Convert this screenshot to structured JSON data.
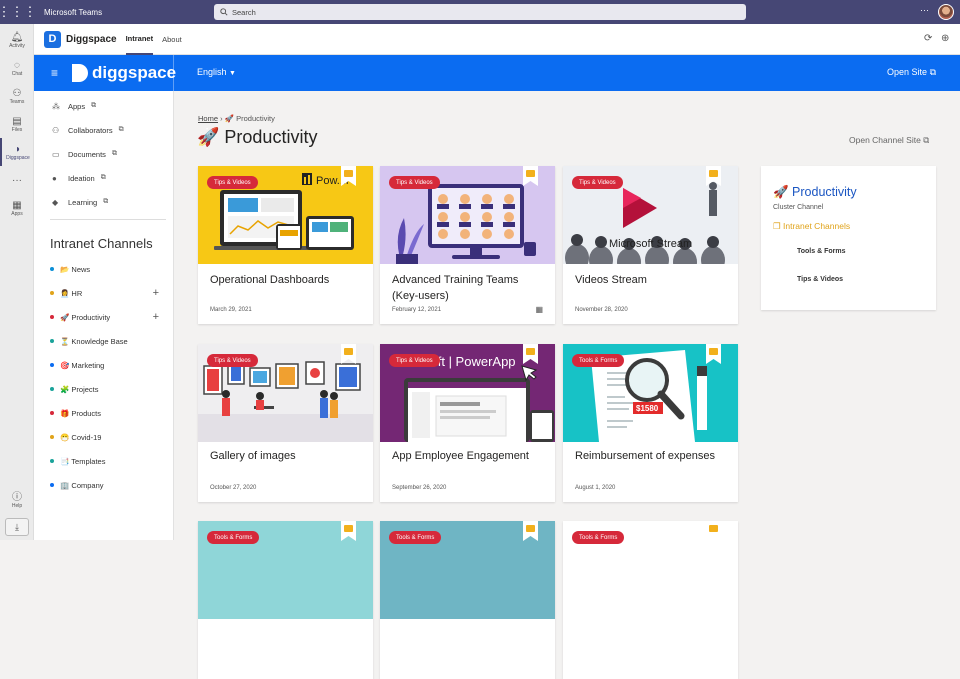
{
  "teams": {
    "app_name": "Microsoft Teams",
    "search_placeholder": "Search",
    "rail": [
      {
        "label": "Activity",
        "icon": "bell-icon"
      },
      {
        "label": "Chat",
        "icon": "chat-icon"
      },
      {
        "label": "Teams",
        "icon": "teams-icon"
      },
      {
        "label": "Files",
        "icon": "files-icon"
      },
      {
        "label": "Diggspace",
        "icon": "diggspace-icon"
      },
      {
        "label": "...",
        "icon": "more-icon"
      },
      {
        "label": "Apps",
        "icon": "apps-icon"
      }
    ],
    "help_label": "Help"
  },
  "tabbar": {
    "app": "Diggspace",
    "tabs": [
      "Intranet",
      "About"
    ]
  },
  "header": {
    "brand": "diggspace",
    "language": "English",
    "open_site": "Open Site"
  },
  "sidebar": {
    "links": [
      "Apps",
      "Collaborators",
      "Documents",
      "Ideation",
      "Learning"
    ],
    "channels_title": "Intranet Channels",
    "channels": [
      {
        "label": "📂 News",
        "color": "#0b8fd6"
      },
      {
        "label": "👩‍💼 HR",
        "color": "#e0a31a"
      },
      {
        "label": "🚀 Productivity",
        "color": "#d6293a"
      },
      {
        "label": "⏳ Knowledge Base",
        "color": "#1aa39a"
      },
      {
        "label": "🎯 Marketing",
        "color": "#0b6cf1"
      },
      {
        "label": "🧩 Projects",
        "color": "#1aa39a"
      },
      {
        "label": "🎁 Products",
        "color": "#d6293a"
      },
      {
        "label": "😷 Covid-19",
        "color": "#e0a31a"
      },
      {
        "label": "📑 Templates",
        "color": "#1aa39a"
      },
      {
        "label": "🏢 Company",
        "color": "#0b6cf1"
      }
    ]
  },
  "main": {
    "breadcrumb_home": "Home",
    "breadcrumb_current": "🚀 Productivity",
    "title": "🚀 Productivity",
    "open_channel": "Open Channel Site",
    "cards": [
      {
        "tag": "Tips & Videos",
        "title": "Operational Dashboards",
        "date": "March 29, 2021",
        "img_text": "Pow...l"
      },
      {
        "tag": "Tips & Videos",
        "title": "Advanced Training Teams (Key-users)",
        "date": "February 12, 2021"
      },
      {
        "tag": "Tips & Videos",
        "title": "Videos Stream",
        "date": "November 28, 2020",
        "img_text": "Microsoft Stream"
      },
      {
        "tag": "Tips & Videos",
        "title": "Gallery of images",
        "date": "October 27, 2020"
      },
      {
        "tag": "Tips & Videos",
        "title": "App Employee Engagement",
        "date": "September 26, 2020",
        "img_text": "soft | PowerApp"
      },
      {
        "tag": "Tools & Forms",
        "title": "Reimbursement of expenses",
        "date": "August 1, 2020",
        "img_text": "$1580"
      },
      {
        "tag": "Tools & Forms"
      },
      {
        "tag": "Tools & Forms"
      },
      {
        "tag": "Tools & Forms"
      }
    ],
    "info": {
      "title": "🚀 Productivity",
      "subtitle": "Cluster Channel",
      "channels_label": "Intranet Channels",
      "items": [
        "Tools & Forms",
        "Tips & Videos"
      ]
    }
  }
}
